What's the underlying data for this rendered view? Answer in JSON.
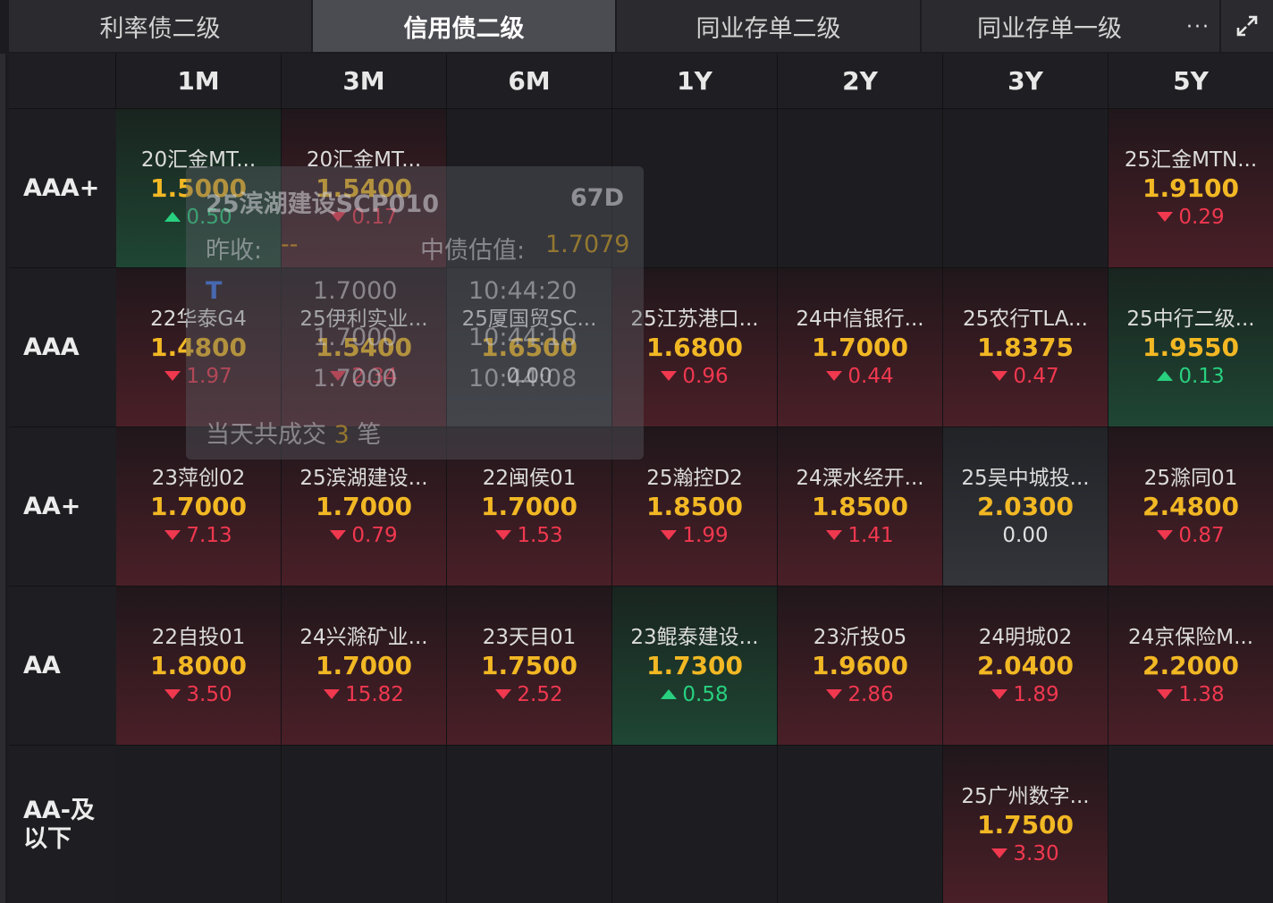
{
  "tabs": [
    {
      "label": "利率债二级",
      "active": false
    },
    {
      "label": "信用债二级",
      "active": true
    },
    {
      "label": "同业存单二级",
      "active": false
    },
    {
      "label": "同业存单一级",
      "active": false
    }
  ],
  "more_label": "···",
  "columns": [
    "1M",
    "3M",
    "6M",
    "1Y",
    "2Y",
    "3Y",
    "5Y"
  ],
  "rows": [
    {
      "label": "AAA+",
      "cells": [
        {
          "name": "20汇金MT...",
          "rate": "1.5000",
          "change": "0.50",
          "dir": "up",
          "tone": "green"
        },
        {
          "name": "20汇金MT...",
          "rate": "1.5400",
          "change": "0.17",
          "dir": "down",
          "tone": "red"
        },
        null,
        null,
        null,
        null,
        {
          "name": "25汇金MTN...",
          "rate": "1.9100",
          "change": "0.29",
          "dir": "down",
          "tone": "red"
        }
      ]
    },
    {
      "label": "AAA",
      "cells": [
        {
          "name": "22华泰G4",
          "rate": "1.4800",
          "change": "1.97",
          "dir": "down",
          "tone": "red"
        },
        {
          "name": "25伊利实业...",
          "rate": "1.5400",
          "change": "2.34",
          "dir": "down",
          "tone": "red"
        },
        {
          "name": "25厦国贸SC...",
          "rate": "1.6500",
          "change": "0.00",
          "dir": "flat",
          "tone": "gray"
        },
        {
          "name": "25江苏港口...",
          "rate": "1.6800",
          "change": "0.96",
          "dir": "down",
          "tone": "red"
        },
        {
          "name": "24中信银行...",
          "rate": "1.7000",
          "change": "0.44",
          "dir": "down",
          "tone": "red"
        },
        {
          "name": "25农行TLA...",
          "rate": "1.8375",
          "change": "0.47",
          "dir": "down",
          "tone": "red"
        },
        {
          "name": "25中行二级...",
          "rate": "1.9550",
          "change": "0.13",
          "dir": "up",
          "tone": "green"
        }
      ]
    },
    {
      "label": "AA+",
      "cells": [
        {
          "name": "23萍创02",
          "rate": "1.7000",
          "change": "7.13",
          "dir": "down",
          "tone": "red"
        },
        {
          "name": "25滨湖建设...",
          "rate": "1.7000",
          "change": "0.79",
          "dir": "down",
          "tone": "red"
        },
        {
          "name": "22闽侯01",
          "rate": "1.7000",
          "change": "1.53",
          "dir": "down",
          "tone": "red"
        },
        {
          "name": "25瀚控D2",
          "rate": "1.8500",
          "change": "1.99",
          "dir": "down",
          "tone": "red"
        },
        {
          "name": "24溧水经开...",
          "rate": "1.8500",
          "change": "1.41",
          "dir": "down",
          "tone": "red"
        },
        {
          "name": "25吴中城投...",
          "rate": "2.0300",
          "change": "0.00",
          "dir": "flat",
          "tone": "gray"
        },
        {
          "name": "25滁同01",
          "rate": "2.4800",
          "change": "0.87",
          "dir": "down",
          "tone": "red"
        }
      ]
    },
    {
      "label": "AA",
      "cells": [
        {
          "name": "22自投01",
          "rate": "1.8000",
          "change": "3.50",
          "dir": "down",
          "tone": "red"
        },
        {
          "name": "24兴滁矿业...",
          "rate": "1.7000",
          "change": "15.82",
          "dir": "down",
          "tone": "red"
        },
        {
          "name": "23天目01",
          "rate": "1.7500",
          "change": "2.52",
          "dir": "down",
          "tone": "red"
        },
        {
          "name": "23鲲泰建设...",
          "rate": "1.7300",
          "change": "0.58",
          "dir": "up",
          "tone": "green"
        },
        {
          "name": "23沂投05",
          "rate": "1.9600",
          "change": "2.86",
          "dir": "down",
          "tone": "red"
        },
        {
          "name": "24明城02",
          "rate": "2.0400",
          "change": "1.89",
          "dir": "down",
          "tone": "red"
        },
        {
          "name": "24京保险M...",
          "rate": "2.2000",
          "change": "1.38",
          "dir": "down",
          "tone": "red"
        }
      ]
    },
    {
      "label": "AA-及以下",
      "label_lines": [
        "AA-及",
        "以下"
      ],
      "cells": [
        null,
        null,
        null,
        null,
        null,
        {
          "name": "25广州数字...",
          "rate": "1.7500",
          "change": "3.30",
          "dir": "down",
          "tone": "red"
        },
        null
      ]
    }
  ],
  "tooltip": {
    "title": "25滨湖建设SCP010",
    "days": "67D",
    "prev_close_label": "昨收:",
    "prev_close_value": "--",
    "valuation_label": "中债估值:",
    "valuation_value": "1.7079",
    "trades": [
      {
        "flag": "T",
        "rate": "1.7000",
        "time": "10:44:20"
      },
      {
        "flag": "",
        "rate": "1.7000",
        "time": "10:44:10"
      },
      {
        "flag": "",
        "rate": "1.7000",
        "time": "10:44:08"
      }
    ],
    "summary_prefix": "当天共成交",
    "summary_count": "3",
    "summary_suffix": "笔"
  },
  "colors": {
    "rate": "#f2b824",
    "down": "#f0384f",
    "up": "#28d07f",
    "active_tab": "#4b4b52"
  },
  "icons": {
    "more": "more-icon",
    "expand": "expand-icon"
  }
}
